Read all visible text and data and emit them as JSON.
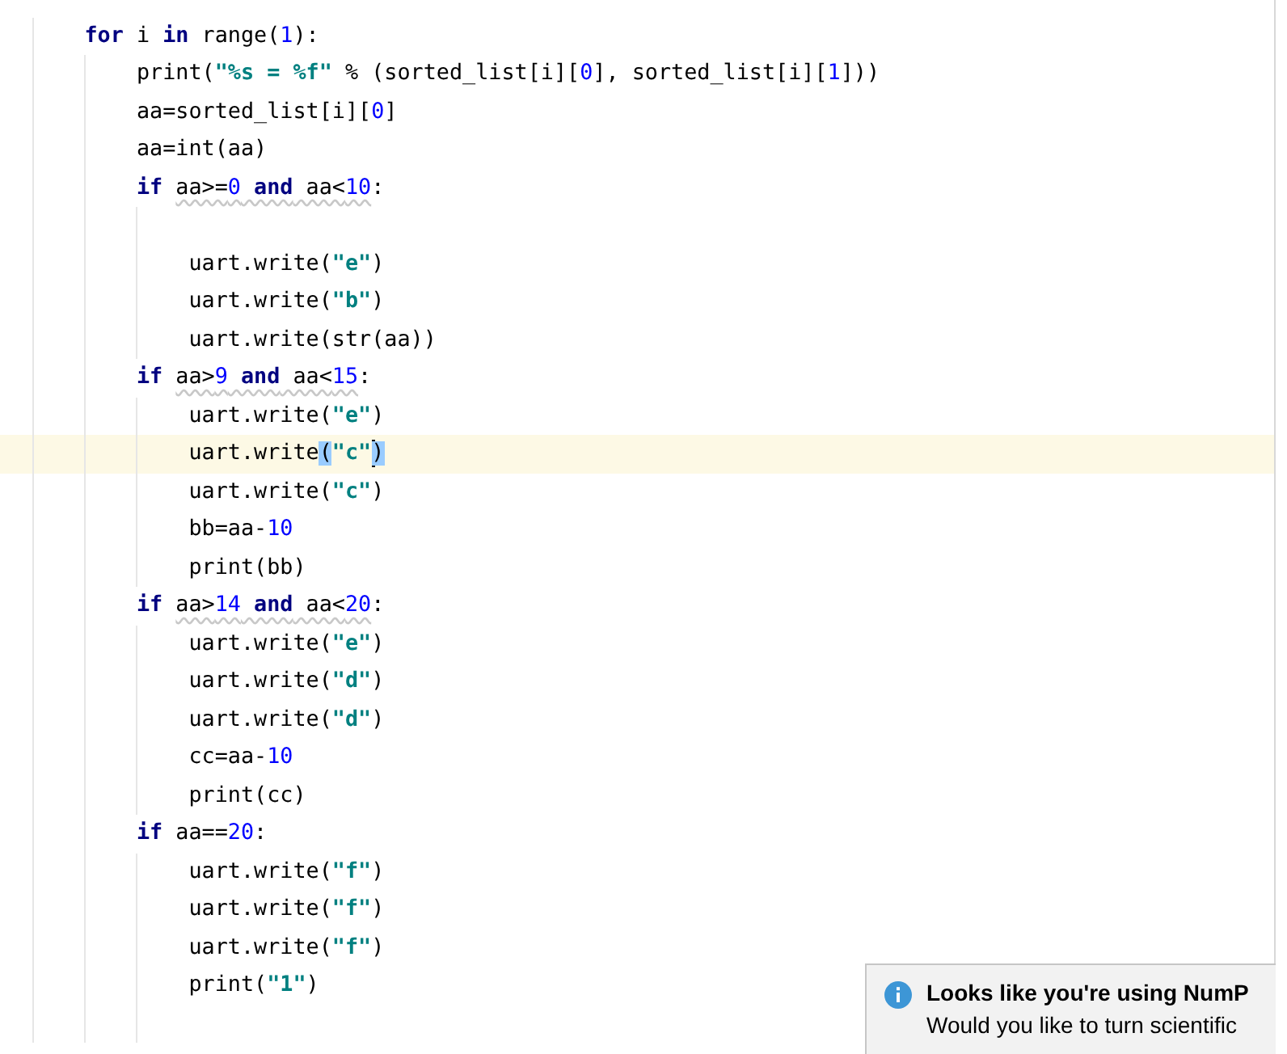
{
  "editor": {
    "lines": [
      {
        "current": false,
        "children": [
          {
            "current": false,
            "tokens": [
              {
                "kind": "kw",
                "text": "for"
              },
              {
                "kind": "txt",
                "text": " i "
              },
              {
                "kind": "kw",
                "text": "in"
              },
              {
                "kind": "txt",
                "text": " range("
              },
              {
                "kind": "num",
                "text": "1"
              },
              {
                "kind": "txt",
                "text": "):"
              }
            ],
            "children": [
              {
                "current": false,
                "tokens": [
                  {
                    "kind": "txt",
                    "text": "print("
                  },
                  {
                    "kind": "str",
                    "text": "\"%s = %f\""
                  },
                  {
                    "kind": "txt",
                    "text": " % (sorted_list[i]["
                  },
                  {
                    "kind": "num",
                    "text": "0"
                  },
                  {
                    "kind": "txt",
                    "text": "], sorted_list[i]["
                  },
                  {
                    "kind": "num",
                    "text": "1"
                  },
                  {
                    "kind": "txt",
                    "text": "]))"
                  }
                ]
              },
              {
                "current": false,
                "tokens": [
                  {
                    "kind": "txt",
                    "text": "aa=sorted_list[i]["
                  },
                  {
                    "kind": "num",
                    "text": "0"
                  },
                  {
                    "kind": "txt",
                    "text": "]"
                  }
                ]
              },
              {
                "current": false,
                "tokens": [
                  {
                    "kind": "txt",
                    "text": "aa=int(aa)"
                  }
                ]
              },
              {
                "current": false,
                "tokens": [
                  {
                    "kind": "kw",
                    "text": "if "
                  },
                  {
                    "kind": "warn",
                    "parts": [
                      {
                        "kind": "txt",
                        "text": "aa>="
                      },
                      {
                        "kind": "num",
                        "text": "0"
                      },
                      {
                        "kind": "kw",
                        "text": " and"
                      },
                      {
                        "kind": "txt",
                        "text": " aa<"
                      },
                      {
                        "kind": "num",
                        "text": "10"
                      }
                    ]
                  },
                  {
                    "kind": "txt",
                    "text": ":"
                  }
                ],
                "children": [
                  {
                    "current": false
                  },
                  {
                    "current": false,
                    "tokens": [
                      {
                        "kind": "txt",
                        "text": "uart.write("
                      },
                      {
                        "kind": "str",
                        "text": "\"e\""
                      },
                      {
                        "kind": "txt",
                        "text": ")"
                      }
                    ]
                  },
                  {
                    "current": false,
                    "tokens": [
                      {
                        "kind": "txt",
                        "text": "uart.write("
                      },
                      {
                        "kind": "str",
                        "text": "\"b\""
                      },
                      {
                        "kind": "txt",
                        "text": ")"
                      }
                    ]
                  },
                  {
                    "current": false,
                    "tokens": [
                      {
                        "kind": "txt",
                        "text": "uart.write(str(aa))"
                      }
                    ]
                  }
                ]
              },
              {
                "current": false,
                "tokens": [
                  {
                    "kind": "kw",
                    "text": "if "
                  },
                  {
                    "kind": "warn",
                    "parts": [
                      {
                        "kind": "txt",
                        "text": "aa>"
                      },
                      {
                        "kind": "num",
                        "text": "9"
                      },
                      {
                        "kind": "kw",
                        "text": " and"
                      },
                      {
                        "kind": "txt",
                        "text": " aa<"
                      },
                      {
                        "kind": "num",
                        "text": "15"
                      }
                    ]
                  },
                  {
                    "kind": "txt",
                    "text": ":"
                  }
                ],
                "children": [
                  {
                    "current": false,
                    "tokens": [
                      {
                        "kind": "txt",
                        "text": "uart.write("
                      },
                      {
                        "kind": "str",
                        "text": "\"e\""
                      },
                      {
                        "kind": "txt",
                        "text": ")"
                      }
                    ]
                  },
                  {
                    "current": true,
                    "tokens": [
                      {
                        "kind": "txt",
                        "text": "uart.write"
                      },
                      {
                        "kind": "match",
                        "text": "("
                      },
                      {
                        "kind": "str",
                        "text": "\"c\""
                      },
                      {
                        "kind": "caret"
                      },
                      {
                        "kind": "match",
                        "text": ")"
                      }
                    ]
                  },
                  {
                    "current": false,
                    "tokens": [
                      {
                        "kind": "txt",
                        "text": "uart.write("
                      },
                      {
                        "kind": "str",
                        "text": "\"c\""
                      },
                      {
                        "kind": "txt",
                        "text": ")"
                      }
                    ]
                  },
                  {
                    "current": false,
                    "tokens": [
                      {
                        "kind": "txt",
                        "text": "bb=aa-"
                      },
                      {
                        "kind": "num",
                        "text": "10"
                      }
                    ]
                  },
                  {
                    "current": false,
                    "tokens": [
                      {
                        "kind": "txt",
                        "text": "print(bb)"
                      }
                    ]
                  }
                ]
              },
              {
                "current": false,
                "tokens": [
                  {
                    "kind": "kw",
                    "text": "if "
                  },
                  {
                    "kind": "warn",
                    "parts": [
                      {
                        "kind": "txt",
                        "text": "aa>"
                      },
                      {
                        "kind": "num",
                        "text": "14"
                      },
                      {
                        "kind": "kw",
                        "text": " and"
                      },
                      {
                        "kind": "txt",
                        "text": " aa<"
                      },
                      {
                        "kind": "num",
                        "text": "20"
                      }
                    ]
                  },
                  {
                    "kind": "txt",
                    "text": ":"
                  }
                ],
                "children": [
                  {
                    "current": false,
                    "tokens": [
                      {
                        "kind": "txt",
                        "text": "uart.write("
                      },
                      {
                        "kind": "str",
                        "text": "\"e\""
                      },
                      {
                        "kind": "txt",
                        "text": ")"
                      }
                    ]
                  },
                  {
                    "current": false,
                    "tokens": [
                      {
                        "kind": "txt",
                        "text": "uart.write("
                      },
                      {
                        "kind": "str",
                        "text": "\"d\""
                      },
                      {
                        "kind": "txt",
                        "text": ")"
                      }
                    ]
                  },
                  {
                    "current": false,
                    "tokens": [
                      {
                        "kind": "txt",
                        "text": "uart.write("
                      },
                      {
                        "kind": "str",
                        "text": "\"d\""
                      },
                      {
                        "kind": "txt",
                        "text": ")"
                      }
                    ]
                  },
                  {
                    "current": false,
                    "tokens": [
                      {
                        "kind": "txt",
                        "text": "cc=aa-"
                      },
                      {
                        "kind": "num",
                        "text": "10"
                      }
                    ]
                  },
                  {
                    "current": false,
                    "tokens": [
                      {
                        "kind": "txt",
                        "text": "print(cc)"
                      }
                    ]
                  }
                ]
              },
              {
                "current": false,
                "tokens": [
                  {
                    "kind": "kw",
                    "text": "if"
                  },
                  {
                    "kind": "txt",
                    "text": " aa=="
                  },
                  {
                    "kind": "num",
                    "text": "20"
                  },
                  {
                    "kind": "txt",
                    "text": ":"
                  }
                ],
                "children": [
                  {
                    "current": false,
                    "tokens": [
                      {
                        "kind": "txt",
                        "text": "uart.write("
                      },
                      {
                        "kind": "str",
                        "text": "\"f\""
                      },
                      {
                        "kind": "txt",
                        "text": ")"
                      }
                    ]
                  },
                  {
                    "current": false,
                    "tokens": [
                      {
                        "kind": "txt",
                        "text": "uart.write("
                      },
                      {
                        "kind": "str",
                        "text": "\"f\""
                      },
                      {
                        "kind": "txt",
                        "text": ")"
                      }
                    ]
                  },
                  {
                    "current": false,
                    "tokens": [
                      {
                        "kind": "txt",
                        "text": "uart.write("
                      },
                      {
                        "kind": "str",
                        "text": "\"f\""
                      },
                      {
                        "kind": "txt",
                        "text": ")"
                      }
                    ]
                  },
                  {
                    "current": false,
                    "tokens": [
                      {
                        "kind": "txt",
                        "text": "print("
                      },
                      {
                        "kind": "str",
                        "text": "\"1\""
                      },
                      {
                        "kind": "txt",
                        "text": ")"
                      }
                    ]
                  },
                  {
                    "current": false
                  }
                ]
              }
            ]
          }
        ]
      }
    ]
  },
  "notification": {
    "title": "Looks like you're using NumP",
    "text": "Would you like to turn scientific"
  }
}
